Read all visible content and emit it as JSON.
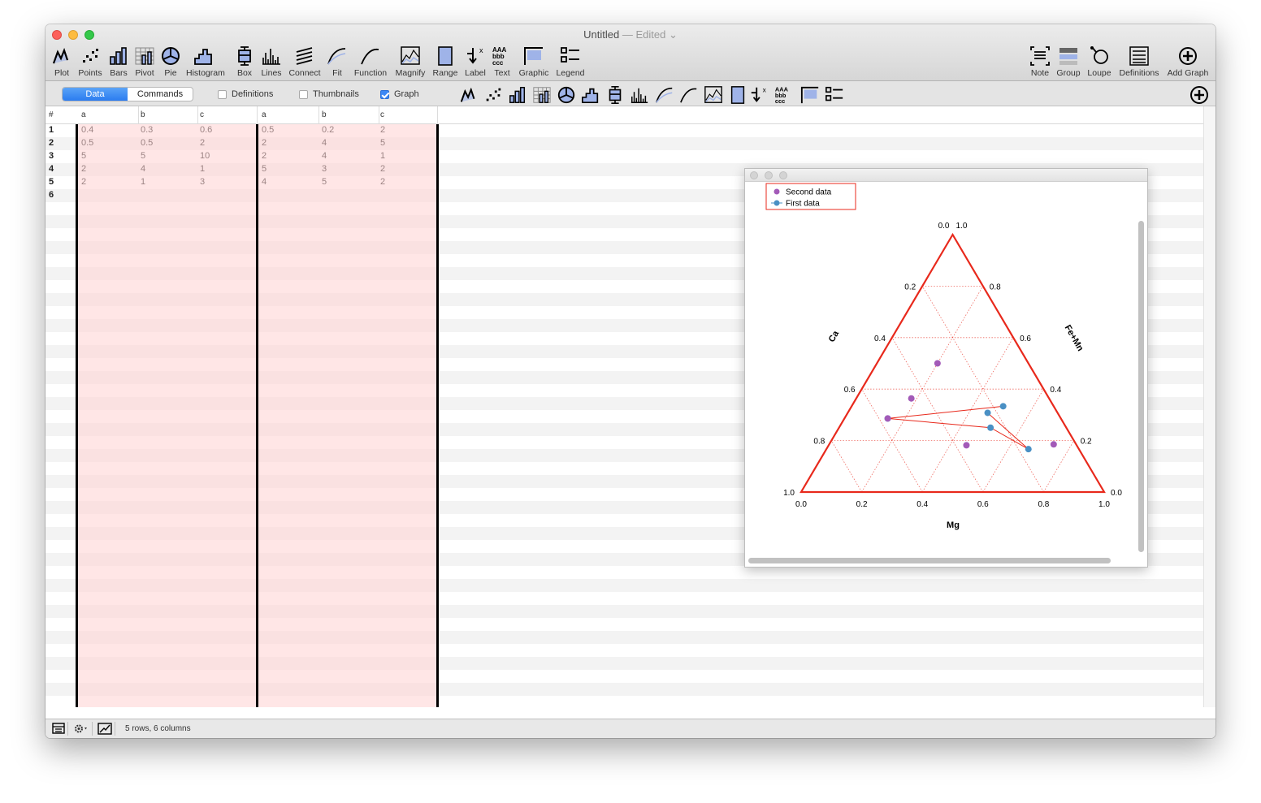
{
  "window": {
    "title": "Untitled",
    "edited": "— Edited"
  },
  "toolbar": {
    "items": [
      {
        "label": "Plot",
        "icon": "plot-icon"
      },
      {
        "label": "Points",
        "icon": "points-icon"
      },
      {
        "label": "Bars",
        "icon": "bars-icon"
      },
      {
        "label": "Pivot",
        "icon": "pivot-icon"
      },
      {
        "label": "Pie",
        "icon": "pie-icon"
      },
      {
        "label": "Histogram",
        "icon": "histogram-icon"
      },
      {
        "label": "Box",
        "icon": "box-icon"
      },
      {
        "label": "Lines",
        "icon": "lines-icon"
      },
      {
        "label": "Connect",
        "icon": "connect-icon"
      },
      {
        "label": "Fit",
        "icon": "fit-icon"
      },
      {
        "label": "Function",
        "icon": "function-icon"
      },
      {
        "label": "Magnify",
        "icon": "magnify-icon"
      },
      {
        "label": "Range",
        "icon": "range-icon"
      },
      {
        "label": "Label",
        "icon": "label-icon"
      },
      {
        "label": "Text",
        "icon": "text-icon"
      },
      {
        "label": "Graphic",
        "icon": "graphic-icon"
      },
      {
        "label": "Legend",
        "icon": "legend-icon"
      }
    ],
    "right_items": [
      {
        "label": "Note",
        "icon": "note-icon"
      },
      {
        "label": "Group",
        "icon": "group-icon"
      },
      {
        "label": "Loupe",
        "icon": "loupe-icon"
      },
      {
        "label": "Definitions",
        "icon": "definitions-icon"
      },
      {
        "label": "Add Graph",
        "icon": "add-graph-icon"
      }
    ]
  },
  "subbar": {
    "seg_data": "Data",
    "seg_commands": "Commands",
    "definitions": "Definitions",
    "definitions_checked": false,
    "thumbnails": "Thumbnails",
    "thumbnails_checked": false,
    "graph": "Graph",
    "graph_checked": true
  },
  "table": {
    "hash": "#",
    "columns": [
      "a",
      "b",
      "c",
      "a",
      "b",
      "c"
    ],
    "rows": [
      {
        "n": "1",
        "cells": [
          "0.4",
          "0.3",
          "0.6",
          "0.5",
          "0.2",
          "2"
        ]
      },
      {
        "n": "2",
        "cells": [
          "0.5",
          "0.5",
          "2",
          "2",
          "4",
          "5"
        ]
      },
      {
        "n": "3",
        "cells": [
          "5",
          "5",
          "10",
          "2",
          "4",
          "1"
        ]
      },
      {
        "n": "4",
        "cells": [
          "2",
          "4",
          "1",
          "5",
          "3",
          "2"
        ]
      },
      {
        "n": "5",
        "cells": [
          "2",
          "1",
          "3",
          "4",
          "5",
          "2"
        ]
      },
      {
        "n": "6",
        "cells": [
          "",
          "",
          "",
          "",
          "",
          ""
        ]
      }
    ]
  },
  "status": {
    "text": "5 rows, 6 columns"
  },
  "colors": {
    "accent": "#2b7cf0",
    "axis": "#e8291c",
    "first": "#4a90c4",
    "second": "#a35ab8"
  },
  "chart_data": {
    "type": "scatter",
    "subtype": "ternary",
    "axes": {
      "bottom": "Mg",
      "left": "Ca",
      "right": "Fe+Mn"
    },
    "ticks": [
      "0.0",
      "0.2",
      "0.4",
      "0.6",
      "0.8",
      "1.0"
    ],
    "grid": true,
    "legend": {
      "position": "top-left",
      "entries": [
        "Second data",
        "First data"
      ]
    },
    "series": [
      {
        "name": "First data",
        "connected": true,
        "color": "#4a90c4",
        "points": [
          {
            "a": 0.4,
            "b": 0.3,
            "c": 0.6
          },
          {
            "a": 0.5,
            "b": 0.5,
            "c": 2
          },
          {
            "a": 5,
            "b": 5,
            "c": 10
          },
          {
            "a": 2,
            "b": 4,
            "c": 1
          },
          {
            "a": 2,
            "b": 1,
            "c": 3
          }
        ]
      },
      {
        "name": "Second data",
        "connected": false,
        "color": "#a35ab8",
        "points": [
          {
            "a": 0.5,
            "b": 0.2,
            "c": 2
          },
          {
            "a": 2,
            "b": 4,
            "c": 5
          },
          {
            "a": 2,
            "b": 4,
            "c": 1
          },
          {
            "a": 5,
            "b": 3,
            "c": 2
          },
          {
            "a": 4,
            "b": 5,
            "c": 2
          }
        ]
      }
    ]
  }
}
